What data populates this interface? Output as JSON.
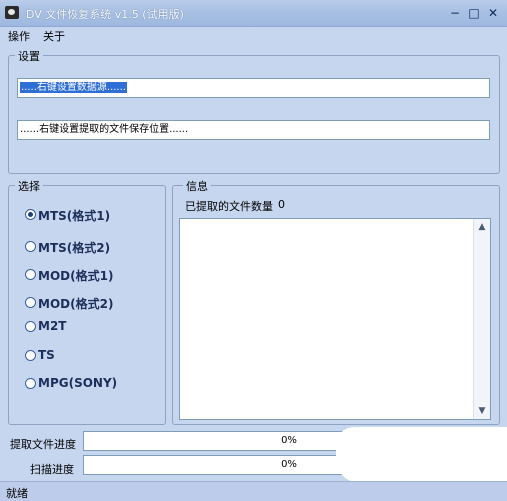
{
  "window": {
    "title": "DV 文件恢复系统 v1.5 (试用版)",
    "controls": {
      "minimize": "−",
      "maximize": "□",
      "close": "✕"
    }
  },
  "menu": [
    "操作",
    "关于"
  ],
  "settings": {
    "label": "设置",
    "source_field": ".....右键设置数据源......",
    "save_field": "......右键设置提取的文件保存位置......"
  },
  "select": {
    "label": "选择",
    "options": [
      {
        "label": "MTS(格式1)",
        "checked": true
      },
      {
        "label": "MTS(格式2)",
        "checked": false
      },
      {
        "label": "MOD(格式1)",
        "checked": false
      },
      {
        "label": "MOD(格式2)",
        "checked": false
      },
      {
        "label": "M2T",
        "checked": false
      },
      {
        "label": "TS",
        "checked": false
      },
      {
        "label": "MPG(SONY)",
        "checked": false
      }
    ]
  },
  "info": {
    "label": "信息",
    "extracted_label": "已提取的文件数量",
    "extracted_count": "0"
  },
  "progress": {
    "extract_label": "提取文件进度",
    "extract_value": "0%",
    "extract_fraction": 0,
    "scan_label": "扫描进度",
    "scan_value": "0%",
    "scan_fraction": 0
  },
  "status": {
    "text": "就绪"
  },
  "icons": {
    "app": "dv-app-icon",
    "scroll_up": "scroll-up-icon",
    "scroll_down": "scroll-down-icon"
  }
}
